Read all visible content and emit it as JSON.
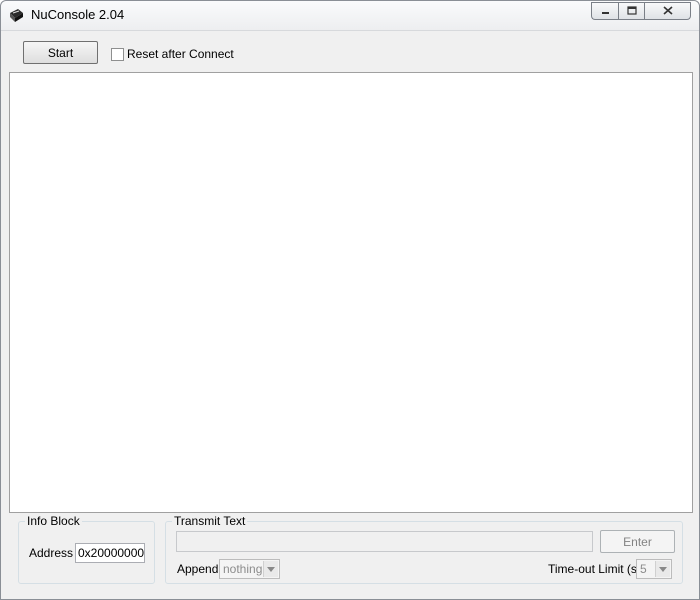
{
  "window": {
    "title": "NuConsole 2.04",
    "icon": "nuvoton-chip-icon"
  },
  "toolbar": {
    "start_label": "Start",
    "reset_checkbox_label": "Reset after Connect",
    "reset_checked": false
  },
  "console": {
    "content": ""
  },
  "info_block": {
    "title": "Info Block",
    "address_label": "Address",
    "address_value": "0x20000000"
  },
  "transmit": {
    "title": "Transmit Text",
    "input_value": "",
    "enter_label": "Enter",
    "append_label": "Append",
    "append_value": "nothing",
    "timeout_label": "Time-out Limit (s)",
    "timeout_value": "5"
  },
  "colors": {
    "window_bg": "#f0f0f0",
    "console_bg": "#ffffff",
    "disabled_text": "#838383"
  }
}
